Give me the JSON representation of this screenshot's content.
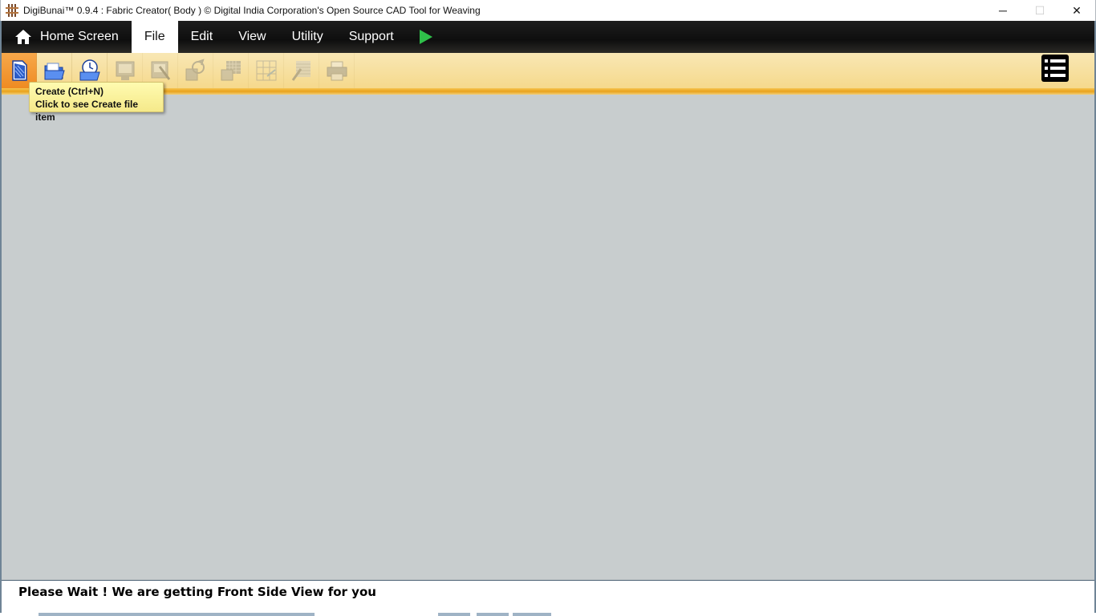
{
  "window": {
    "title": "DigiBunai™ 0.9.4 : Fabric Creator( Body ) © Digital India Corporation's Open Source CAD Tool for Weaving",
    "minimize_glyph": "─",
    "maximize_glyph": "☐",
    "close_glyph": "✕"
  },
  "menubar": {
    "home_label": "Home Screen",
    "items": [
      {
        "label": "File",
        "active": true
      },
      {
        "label": "Edit",
        "active": false
      },
      {
        "label": "View",
        "active": false
      },
      {
        "label": "Utility",
        "active": false
      },
      {
        "label": "Support",
        "active": false
      }
    ],
    "run_icon": "play-icon"
  },
  "toolbar": {
    "tools": [
      {
        "icon": "create-file-icon",
        "enabled": true,
        "active": true
      },
      {
        "icon": "open-folder-icon",
        "enabled": true,
        "active": false
      },
      {
        "icon": "recent-files-icon",
        "enabled": true,
        "active": false
      },
      {
        "icon": "save-icon",
        "enabled": false,
        "active": false
      },
      {
        "icon": "save-as-icon",
        "enabled": false,
        "active": false
      },
      {
        "icon": "export-icon",
        "enabled": false,
        "active": false
      },
      {
        "icon": "export-texture-icon",
        "enabled": false,
        "active": false
      },
      {
        "icon": "export-grid-icon",
        "enabled": false,
        "active": false
      },
      {
        "icon": "export-simulation-icon",
        "enabled": false,
        "active": false
      },
      {
        "icon": "print-icon",
        "enabled": false,
        "active": false
      }
    ],
    "menu_toggle_icon": "hamburger-menu-icon"
  },
  "tooltip": {
    "line1": "Create (Ctrl+N)",
    "line2": "Click to see Create file item"
  },
  "status": {
    "message": "Please Wait ! We are getting Front Side View for you"
  },
  "colors": {
    "menubar_bg": "#111111",
    "toolbar_bg": "#f6d98c",
    "accent_orange": "#ef8b22",
    "workspace_bg": "#c8cdce",
    "tooltip_bg": "#fff7a0"
  }
}
